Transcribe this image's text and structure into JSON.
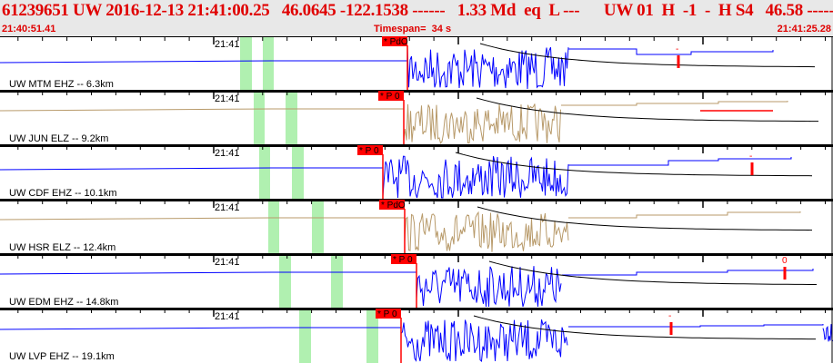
{
  "header": {
    "title": "61239651 UW 2016-12-13 21:41:00.25   46.0645 -122.1538 ------   1.33 Md  eq  L ---      UW 01  H  -1  -  H S4   46.58 -----",
    "start_time": "21:40:51.41",
    "timespan": "Timespan=  34 s",
    "end_time": "21:41:25.28"
  },
  "colors": {
    "vertical": "#0000ff",
    "horizontal": "#b89a6a",
    "pick": "#ff0000",
    "window": "#b0f0b0"
  },
  "panels": [
    {
      "label": "UW MTM EHZ -- 6.3km",
      "minute": "21:41",
      "pick": "* PdO",
      "comp": "vertical",
      "marker": "-"
    },
    {
      "label": "UW JUN ELZ -- 9.2km",
      "minute": "21:41",
      "pick": "* P 0",
      "comp": "horizontal",
      "marker": ""
    },
    {
      "label": "UW CDF EHZ -- 10.1km",
      "minute": "21:41",
      "pick": "* P 0",
      "comp": "vertical",
      "marker": "-"
    },
    {
      "label": "UW HSR ELZ -- 12.4km",
      "minute": "21:41",
      "pick": "* PdO",
      "comp": "horizontal",
      "marker": ""
    },
    {
      "label": "UW EDM EHZ -- 14.8km",
      "minute": "21:41",
      "pick": "* P 0",
      "comp": "vertical",
      "marker": "0"
    },
    {
      "label": "UW LVP EHZ -- 19.1km",
      "minute": "21:41",
      "pick": "* P 0",
      "comp": "vertical",
      "marker": "-"
    }
  ]
}
